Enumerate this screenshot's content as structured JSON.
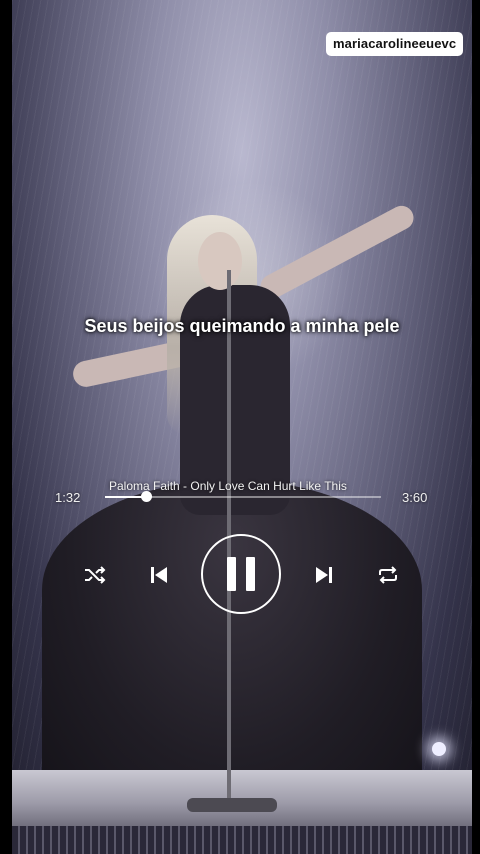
{
  "overlay": {
    "username": "mariacarolineeuevc",
    "lyric": "Seus beijos queimando a minha pele"
  },
  "player": {
    "song_title": "Paloma Faith - Only Love Can Hurt Like This",
    "elapsed": "1:32",
    "total": "3:60",
    "progress": 0.15,
    "state": "playing",
    "icons": {
      "shuffle": "shuffle-icon",
      "previous": "skip-previous-icon",
      "play_pause": "pause-icon",
      "next": "skip-next-icon",
      "repeat": "repeat-icon"
    },
    "accent_color": "#ffffff"
  }
}
